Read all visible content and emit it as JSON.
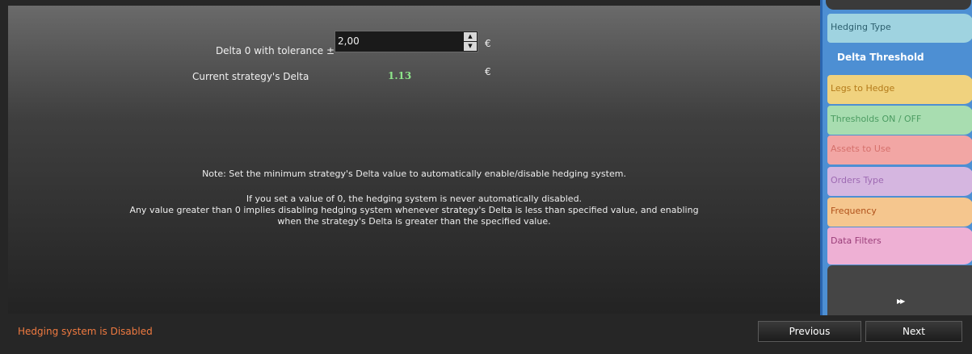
{
  "form": {
    "delta_label": "Delta 0 with tolerance ±",
    "delta_value": "2,00",
    "delta_unit": "€",
    "current_label": "Current strategy's Delta",
    "current_value": "1.13",
    "current_unit": "€"
  },
  "notes": {
    "line1": "Note: Set the minimum strategy's Delta value to automatically enable/disable hedging system.",
    "line2": "If you set a value of 0, the hedging system is never automatically disabled.",
    "line3": "Any value greater than 0 implies disabling hedging system whenever strategy's Delta is less than specified value, and enabling",
    "line4": "when the strategy's Delta is greater than the specified value."
  },
  "sidebar": {
    "tabs": [
      {
        "label": "Hedging Type"
      },
      {
        "label": "Delta Threshold"
      },
      {
        "label": "Legs to Hedge"
      },
      {
        "label": "Thresholds ON / OFF"
      },
      {
        "label": "Assets to Use"
      },
      {
        "label": "Orders Type"
      },
      {
        "label": "Frequency"
      },
      {
        "label": "Data Filters"
      }
    ],
    "active_tab": "Delta Threshold"
  },
  "footer": {
    "status": "Hedging system is Disabled",
    "previous_label": "Previous",
    "next_label": "Next"
  },
  "icons": {
    "spin_up": "spin-up-arrow-icon",
    "spin_down": "spin-down-arrow-icon",
    "fast_forward": "fast-forward-icon"
  },
  "colors": {
    "current_value": "#8de58a",
    "status_text": "#f07a40",
    "sidebar_accent": "#4d8fd3"
  }
}
